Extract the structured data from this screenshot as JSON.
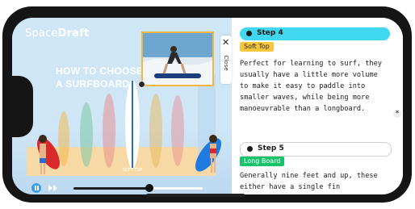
{
  "video": {
    "logo_light": "Space",
    "logo_bold": "Draft",
    "title": "HOW TO CHOOSE A SURFBOARD",
    "card_label": "SOFT TOP",
    "progress": 0.59,
    "close_label": "Close"
  },
  "steps": [
    {
      "header": "Step 4",
      "tag": "Soft Top",
      "text": "Perfect for learning to surf, they usually have a little more volume to make it easy to paddle into smaller waves, while being more manoeuvrable than a longboard."
    },
    {
      "header": "Step 5",
      "tag": "Long Board",
      "text": "Generally nine feet and up, these either have a single fin"
    }
  ],
  "side_button": "*",
  "colors": {
    "step_active": "#3fd8f0",
    "tag_softtop": "#f7c63c",
    "tag_longboard": "#19c36a",
    "play": "#3aa0e8"
  }
}
